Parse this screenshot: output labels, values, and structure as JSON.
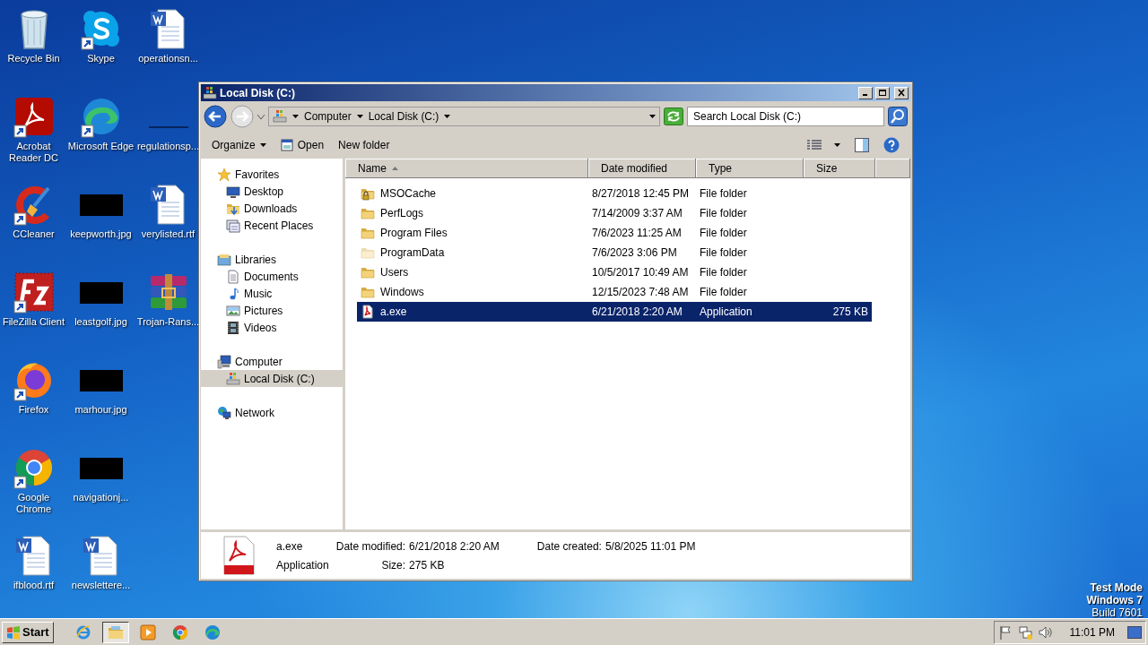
{
  "desktop": {
    "columns": [
      [
        {
          "label": "Recycle Bin",
          "kind": "recycle",
          "shortcut": false
        },
        {
          "label": "Acrobat Reader DC",
          "kind": "acrobat",
          "shortcut": true
        },
        {
          "label": "CCleaner",
          "kind": "ccleaner",
          "shortcut": true
        },
        {
          "label": "FileZilla Client",
          "kind": "filezilla",
          "shortcut": true
        },
        {
          "label": "Firefox",
          "kind": "firefox",
          "shortcut": true
        },
        {
          "label": "Google Chrome",
          "kind": "chrome",
          "shortcut": true
        },
        {
          "label": "ifblood.rtf",
          "kind": "word",
          "shortcut": false
        }
      ],
      [
        {
          "label": "Skype",
          "kind": "skype",
          "shortcut": true
        },
        {
          "label": "Microsoft Edge",
          "kind": "edge",
          "shortcut": true
        },
        {
          "label": "keepworth.jpg",
          "kind": "thumb",
          "shortcut": false
        },
        {
          "label": "leastgolf.jpg",
          "kind": "thumb",
          "shortcut": false
        },
        {
          "label": "marhour.jpg",
          "kind": "thumb",
          "shortcut": false
        },
        {
          "label": "navigationj...",
          "kind": "thumb",
          "shortcut": false
        },
        {
          "label": "newslettere...",
          "kind": "word",
          "shortcut": false
        }
      ],
      [
        {
          "label": "operationsn...",
          "kind": "word",
          "shortcut": false
        },
        {
          "label": "regulationsp...",
          "kind": "blank",
          "shortcut": false
        },
        {
          "label": "verylisted.rtf",
          "kind": "word",
          "shortcut": false
        },
        {
          "label": "Trojan-Rans...",
          "kind": "winrar",
          "shortcut": false
        }
      ]
    ]
  },
  "window": {
    "title": "Local Disk (C:)",
    "breadcrumb": [
      "Computer",
      "Local Disk (C:)"
    ],
    "search": {
      "placeholder": "Search Local Disk (C:)"
    },
    "toolbar": [
      {
        "label": "Organize",
        "kind": "menu"
      },
      {
        "label": "Open",
        "kind": "open"
      },
      {
        "label": "New folder",
        "kind": "plain"
      }
    ],
    "nav": [
      {
        "label": "Favorites",
        "kind": "star",
        "selected": false,
        "children": [
          {
            "label": "Desktop",
            "kind": "desktop",
            "selected": false
          },
          {
            "label": "Downloads",
            "kind": "downloads",
            "selected": false
          },
          {
            "label": "Recent Places",
            "kind": "recent",
            "selected": false
          }
        ]
      },
      {
        "label": "Libraries",
        "kind": "libraries",
        "selected": false,
        "children": [
          {
            "label": "Documents",
            "kind": "documents",
            "selected": false
          },
          {
            "label": "Music",
            "kind": "music",
            "selected": false
          },
          {
            "label": "Pictures",
            "kind": "pictures",
            "selected": false
          },
          {
            "label": "Videos",
            "kind": "videos",
            "selected": false
          }
        ]
      },
      {
        "label": "Computer",
        "kind": "computer",
        "selected": false,
        "children": [
          {
            "label": "Local Disk (C:)",
            "kind": "disk",
            "selected": true
          }
        ]
      },
      {
        "label": "Network",
        "kind": "network",
        "selected": false
      }
    ],
    "columns": [
      {
        "label": "Name",
        "sorted": true
      },
      {
        "label": "Date modified",
        "sorted": false
      },
      {
        "label": "Type",
        "sorted": false
      },
      {
        "label": "Size",
        "sorted": false
      }
    ],
    "rows": [
      {
        "name": "MSOCache",
        "date": "8/27/2018 12:45 PM",
        "type": "File folder",
        "kind": "locked-folder",
        "selected": false
      },
      {
        "name": "PerfLogs",
        "date": "7/14/2009 3:37 AM",
        "type": "File folder",
        "kind": "folder",
        "selected": false
      },
      {
        "name": "Program Files",
        "date": "7/6/2023 11:25 AM",
        "type": "File folder",
        "kind": "folder",
        "selected": false
      },
      {
        "name": "ProgramData",
        "date": "7/6/2023 3:06 PM",
        "type": "File folder",
        "kind": "hidden-folder",
        "selected": false
      },
      {
        "name": "Users",
        "date": "10/5/2017 10:49 AM",
        "type": "File folder",
        "kind": "folder",
        "selected": false
      },
      {
        "name": "Windows",
        "date": "12/15/2023 7:48 AM",
        "type": "File folder",
        "kind": "folder",
        "selected": false
      },
      {
        "name": "a.exe",
        "date": "6/21/2018 2:20 AM",
        "type": "Application",
        "size": "275 KB",
        "kind": "pdf",
        "selected": true
      }
    ],
    "details": {
      "name": "a.exe",
      "type": "Application",
      "fields": [
        {
          "label": "Date modified:",
          "value": "6/21/2018 2:20 AM"
        },
        {
          "label": "Size:",
          "value": "275 KB"
        },
        {
          "label": "Date created:",
          "value": "5/8/2025 11:01 PM"
        }
      ]
    }
  },
  "taskbar": {
    "start": "Start",
    "apps": [
      {
        "kind": "ie",
        "active": false
      },
      {
        "kind": "explorer",
        "active": true
      },
      {
        "kind": "media",
        "active": false
      },
      {
        "kind": "chrome",
        "active": false
      },
      {
        "kind": "edge",
        "active": false
      }
    ],
    "tray": [
      {
        "kind": "flag"
      },
      {
        "kind": "network"
      },
      {
        "kind": "volume"
      }
    ],
    "clock": "11:01 PM"
  },
  "test_mode": [
    {
      "text": "Test Mode",
      "bold": true
    },
    {
      "text": "Windows 7",
      "bold": true
    },
    {
      "text": "Build 7601",
      "bold": false
    }
  ]
}
